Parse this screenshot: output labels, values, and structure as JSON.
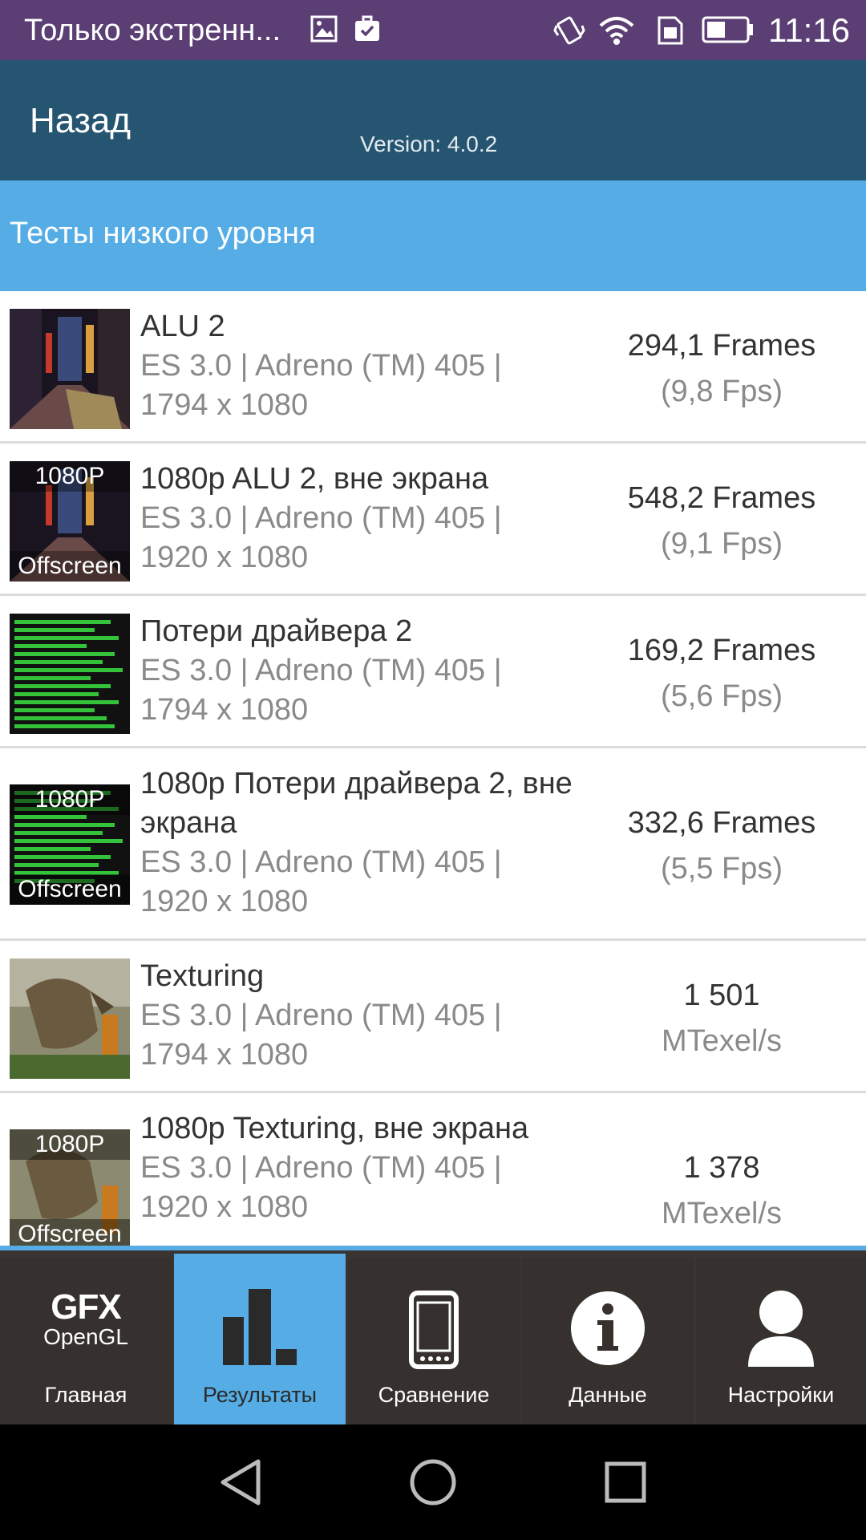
{
  "status_bar": {
    "notification_text": "Только экстренн...",
    "time": "11:16"
  },
  "header": {
    "back_label": "Назад",
    "version": "Version: 4.0.2"
  },
  "section": {
    "title": "Тесты низкого уровня"
  },
  "results": [
    {
      "title": "ALU 2",
      "subtitle": "ES 3.0 | Adreno (TM) 405 | 1794 x 1080",
      "score": "294,1 Frames",
      "score_sub": "(9,8 Fps)",
      "thumb_icon": "alu-thumbnail",
      "thumb_badge_top": "",
      "thumb_badge_bottom": ""
    },
    {
      "title": "1080p ALU 2, вне экрана",
      "subtitle": "ES 3.0 | Adreno (TM) 405 | 1920 x 1080",
      "score": "548,2 Frames",
      "score_sub": "(9,1 Fps)",
      "thumb_icon": "alu-offscreen-thumbnail",
      "thumb_badge_top": "1080P",
      "thumb_badge_bottom": "Offscreen"
    },
    {
      "title": "Потери драйвера 2",
      "subtitle": "ES 3.0 | Adreno (TM) 405 | 1794 x 1080",
      "score": "169,2 Frames",
      "score_sub": "(5,6 Fps)",
      "thumb_icon": "driver-overhead-thumbnail",
      "thumb_badge_top": "",
      "thumb_badge_bottom": ""
    },
    {
      "title": "1080p Потери драйвера 2, вне экрана",
      "subtitle": "ES 3.0 | Adreno (TM) 405 | 1920 x 1080",
      "score": "332,6 Frames",
      "score_sub": "(5,5 Fps)",
      "thumb_icon": "driver-overhead-offscreen-thumbnail",
      "thumb_badge_top": "1080P",
      "thumb_badge_bottom": "Offscreen"
    },
    {
      "title": "Texturing",
      "subtitle": "ES 3.0 | Adreno (TM) 405 | 1794 x 1080",
      "score": "1 501",
      "score_sub": "MTexel/s",
      "thumb_icon": "texturing-thumbnail",
      "thumb_badge_top": "",
      "thumb_badge_bottom": ""
    },
    {
      "title": "1080p Texturing, вне экрана",
      "subtitle": "ES 3.0 | Adreno (TM) 405 | 1920 x 1080",
      "score": "1 378",
      "score_sub": "MTexel/s",
      "thumb_icon": "texturing-offscreen-thumbnail",
      "thumb_badge_top": "1080P",
      "thumb_badge_bottom": "Offscreen"
    }
  ],
  "tabs": [
    {
      "label": "Главная",
      "icon": "gfx-opengl-logo",
      "logo_top": "GFX",
      "logo_bottom": "OpenGL",
      "active": false
    },
    {
      "label": "Результаты",
      "icon": "bar-chart-icon",
      "active": true
    },
    {
      "label": "Сравнение",
      "icon": "phone-icon",
      "active": false
    },
    {
      "label": "Данные",
      "icon": "info-icon",
      "active": false
    },
    {
      "label": "Настройки",
      "icon": "user-icon",
      "active": false
    }
  ],
  "colors": {
    "status_bar": "#5b3f74",
    "header": "#265572",
    "accent": "#56ade6",
    "tab_bar": "#36312e"
  }
}
